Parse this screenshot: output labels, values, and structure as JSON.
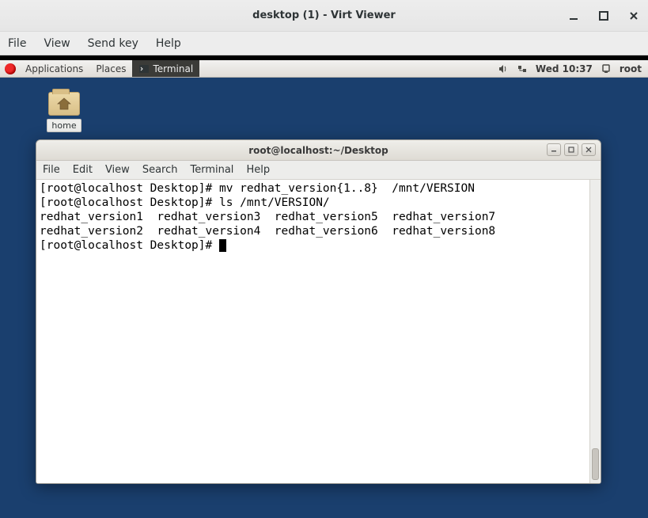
{
  "virt_viewer": {
    "title": "desktop (1) - Virt Viewer",
    "menu": {
      "file": "File",
      "view": "View",
      "send_key": "Send key",
      "help": "Help"
    }
  },
  "panel": {
    "applications": "Applications",
    "places": "Places",
    "task_terminal": "Terminal",
    "clock": "Wed 10:37",
    "user": "root"
  },
  "desktop": {
    "home_label": "home"
  },
  "terminal": {
    "title": "root@localhost:~/Desktop",
    "menu": {
      "file": "File",
      "edit": "Edit",
      "view": "View",
      "search": "Search",
      "terminal": "Terminal",
      "help": "Help"
    },
    "lines": [
      "[root@localhost Desktop]# mv redhat_version{1..8}  /mnt/VERSION",
      "[root@localhost Desktop]# ls /mnt/VERSION/",
      "redhat_version1  redhat_version3  redhat_version5  redhat_version7",
      "redhat_version2  redhat_version4  redhat_version6  redhat_version8",
      "[root@localhost Desktop]# "
    ]
  }
}
